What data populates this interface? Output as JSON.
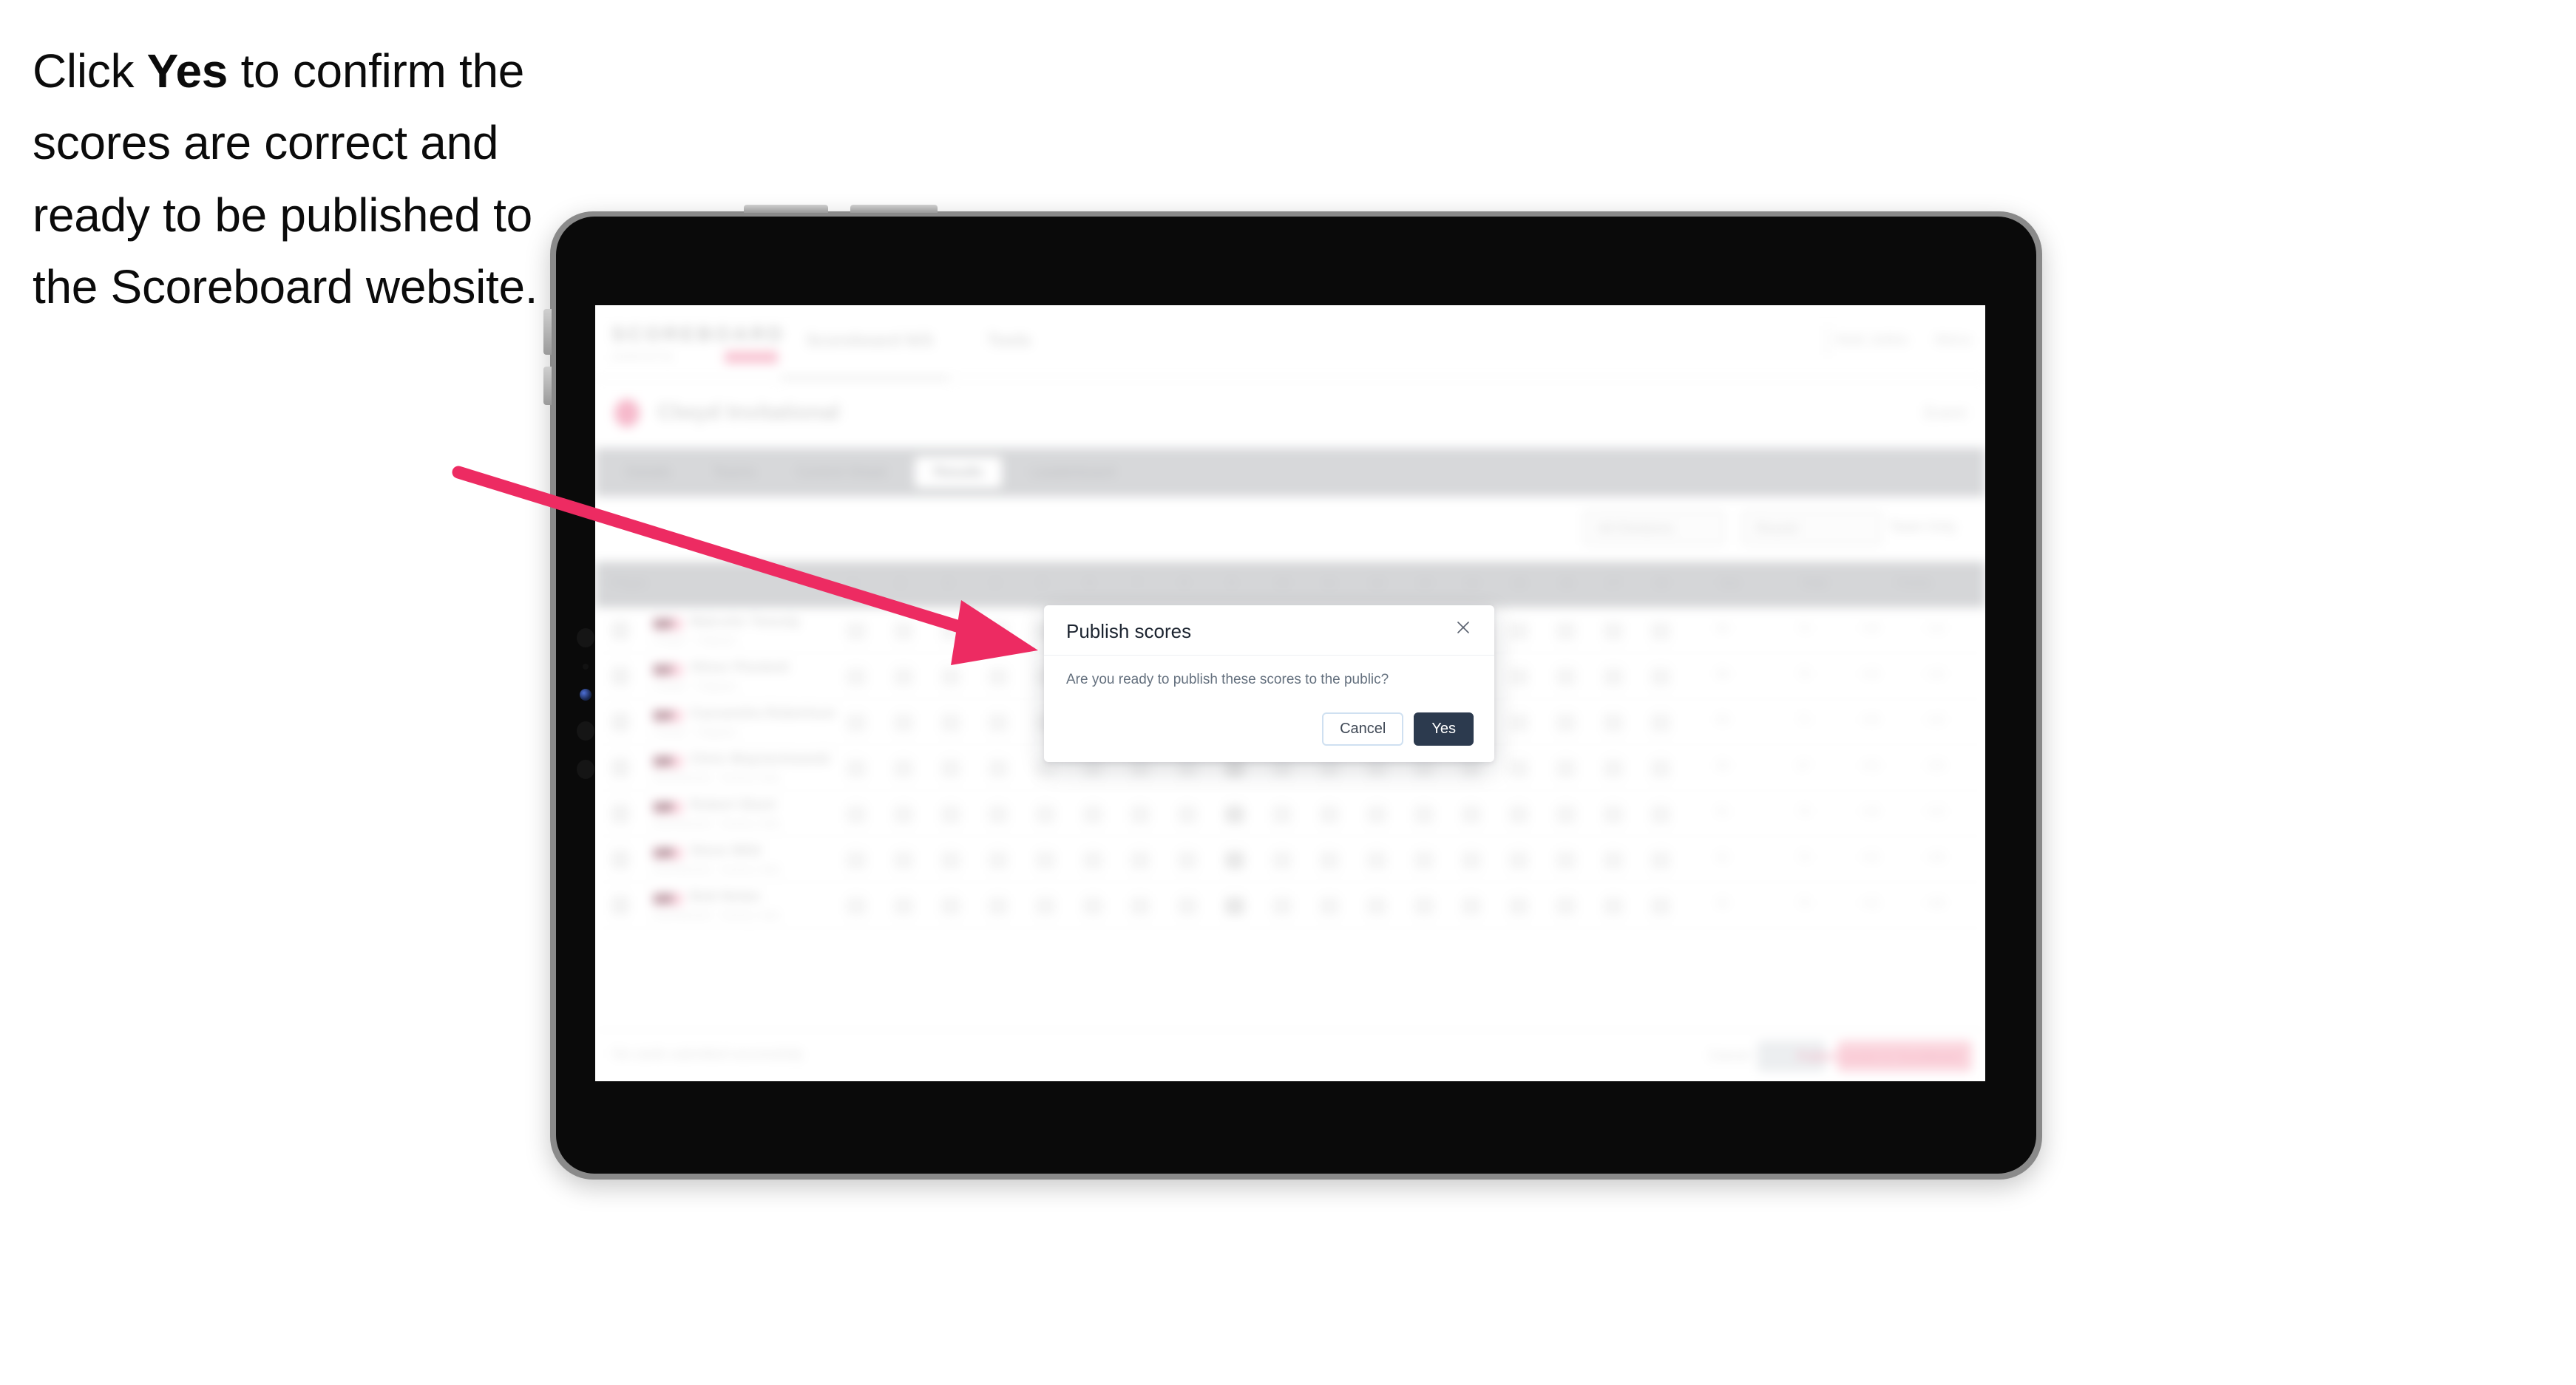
{
  "instruction": {
    "before": "Click ",
    "bold": "Yes",
    "after": " to confirm the scores are correct and ready to be published to the Scoreboard website."
  },
  "colors": {
    "arrow": "#ed2b62",
    "modal_primary": "#2c3a4e",
    "modal_secondary_border": "#cfe0f1",
    "brand_pink": "#f06292",
    "device_bezel": "#8a8a8a",
    "device_screen": "#0a0a0a"
  },
  "modal": {
    "title": "Publish scores",
    "body": "Are you ready to publish these scores to the public?",
    "close_icon": "close-icon",
    "cancel_label": "Cancel",
    "confirm_label": "Yes"
  },
  "app": {
    "logo": "SCOREBOARD",
    "logo_sub": "powered by",
    "nav": [
      "Scoreboard N/S",
      "Tools"
    ],
    "header_right": [
      "Matt Jobbs",
      "Menu"
    ],
    "page_title": "Clwyd Invitational",
    "page_title_suffix": "Event",
    "page_right": "Event",
    "tabs": [
      {
        "label": "Details",
        "active": false
      },
      {
        "label": "Teams",
        "active": false
      },
      {
        "label": "Control Sheet",
        "active": false
      },
      {
        "label": "Results",
        "active": true
      },
      {
        "label": "Leaderboard",
        "active": false
      }
    ],
    "filters": [
      {
        "label": "All Divisions",
        "type": "select"
      },
      {
        "label": "Round",
        "type": "select"
      },
      {
        "label": "Team Only",
        "type": "plain"
      }
    ],
    "table": {
      "columns": [
        "Player",
        "1",
        "2",
        "3",
        "4",
        "5",
        "6",
        "7",
        "8",
        "9",
        "10",
        "11",
        "12",
        "13",
        "14",
        "15",
        "16",
        "17",
        "18",
        "Out",
        "Total",
        "Points"
      ],
      "rows": [
        {
          "badge": "110",
          "name": "Malcolm Tweedy",
          "sub": "Clwyd - Cilgwyn",
          "total": "88",
          "points": "70",
          "score_a": "+04",
          "score_b": "+10"
        },
        {
          "badge": "112",
          "name": "Oliver Plunkett",
          "sub": "Clwyd - Cilgwyn",
          "total": "88",
          "points": "70",
          "score_a": "+04",
          "score_b": "+10"
        },
        {
          "badge": "114",
          "name": "Cassandra Robertson",
          "sub": "Clwyd - Cilgwyn",
          "total": "89",
          "points": "71",
          "score_a": "+04",
          "score_b": "+10"
        },
        {
          "badge": "116",
          "name": "Chris Wojciechowski",
          "sub": "Northwood - Sunny Vale",
          "total": "88",
          "points": "67",
          "score_a": "+03",
          "score_b": "+09"
        },
        {
          "badge": "118",
          "name": "Robert Short",
          "sub": "Northwood - Sunny Vale",
          "total": "91",
          "points": "70",
          "score_a": "+04",
          "score_b": "+10"
        },
        {
          "badge": "120",
          "name": "Steve Wild",
          "sub": "Northwood - Sunny Vale",
          "total": "92",
          "points": "70",
          "score_a": "+02",
          "score_b": "+08"
        },
        {
          "badge": "122",
          "name": "Bob Nolan",
          "sub": "Northwood - Sunny Vale",
          "total": "92",
          "points": "70",
          "score_a": "+02",
          "score_b": "+08"
        }
      ]
    },
    "bottom": {
      "status": "No cards submitted successfully",
      "link": "Cancel",
      "secondary_label": "Save",
      "primary_label": "Publish scores to Scoreboard"
    }
  }
}
